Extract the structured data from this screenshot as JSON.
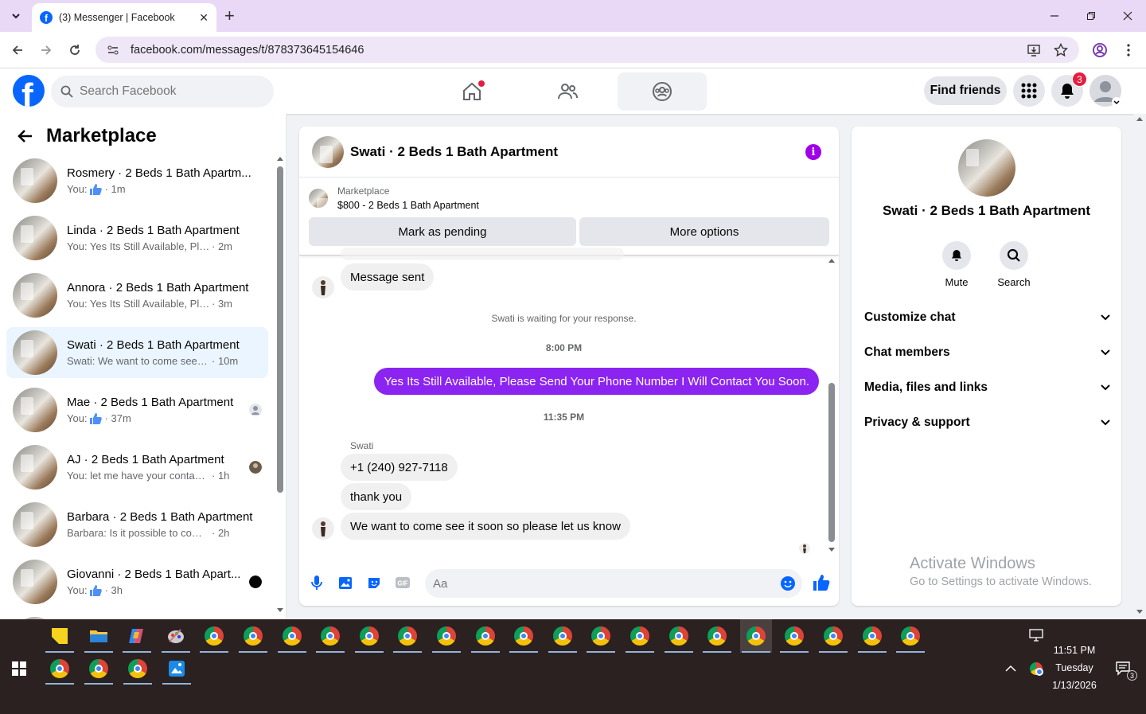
{
  "browser": {
    "tab_title": "(3) Messenger | Facebook",
    "url": "facebook.com/messages/t/878373645154646",
    "new_tab": "+",
    "close_tab": "✕"
  },
  "header": {
    "search_placeholder": "Search Facebook",
    "find_friends": "Find friends",
    "notification_count": "3"
  },
  "sidebar": {
    "title": "Marketplace",
    "conversations": [
      {
        "name": "Rosmery · 2 Beds 1 Bath Apartm...",
        "preview": "You:",
        "thumb": true,
        "time": "· 1m"
      },
      {
        "name": "Linda · 2 Beds 1 Bath Apartment",
        "preview": "You: Yes Its Still Available, Please S...",
        "thumb": false,
        "time": "· 2m"
      },
      {
        "name": "Annora · 2 Beds 1 Bath Apartment",
        "preview": "You: Yes Its Still Available, Please S...",
        "thumb": false,
        "time": "· 3m"
      },
      {
        "name": "Swati · 2 Beds 1 Bath Apartment",
        "preview": "Swati: We want to come see it so...",
        "thumb": false,
        "time": "· 10m"
      },
      {
        "name": "Mae · 2 Beds 1 Bath Apartment",
        "preview": "You:",
        "thumb": true,
        "time": "· 37m"
      },
      {
        "name": "AJ · 2 Beds 1 Bath Apartment",
        "preview": "You: let me have your contact nu...",
        "thumb": false,
        "time": "· 1h"
      },
      {
        "name": "Barbara · 2 Beds 1 Bath Apartment",
        "preview": "Barbara: Is it possible to come by si...",
        "thumb": false,
        "time": "· 2h"
      },
      {
        "name": "Giovanni · 2 Beds 1 Bath Apart...",
        "preview": "You:",
        "thumb": true,
        "time": "· 3h"
      }
    ]
  },
  "chat": {
    "title": "Swati · 2 Beds 1 Bath Apartment",
    "listing_source": "Marketplace",
    "listing_title": "$800 - 2 Beds 1 Bath Apartment",
    "mark_pending": "Mark as pending",
    "more_options": "More options",
    "msg_sent": "Message sent",
    "waiting": "Swati is waiting for your response.",
    "time1": "8:00 PM",
    "outgoing": "Yes Its Still Available, Please Send Your Phone Number I Will Contact You Soon.",
    "time2": "11:35 PM",
    "sender": "Swati",
    "in1": "+1 (240) 927-7118",
    "in2": "thank you",
    "in3": "We want to come see it soon so please let us know",
    "composer_placeholder": "Aa"
  },
  "details": {
    "name": "Swati · 2 Beds 1 Bath Apartment",
    "mute": "Mute",
    "search": "Search",
    "sections": [
      "Customize chat",
      "Chat members",
      "Media, files and links",
      "Privacy & support"
    ]
  },
  "watermark": {
    "line1": "Activate Windows",
    "line2": "Go to Settings to activate Windows."
  },
  "taskbar": {
    "time": "11:51 PM",
    "day": "Tuesday",
    "date": "1/13/2026",
    "notif_count": "3"
  },
  "colors": {
    "accent": "#0866ff",
    "outgoing_bubble": "#8b24f0",
    "badge": "#e41e3f"
  }
}
